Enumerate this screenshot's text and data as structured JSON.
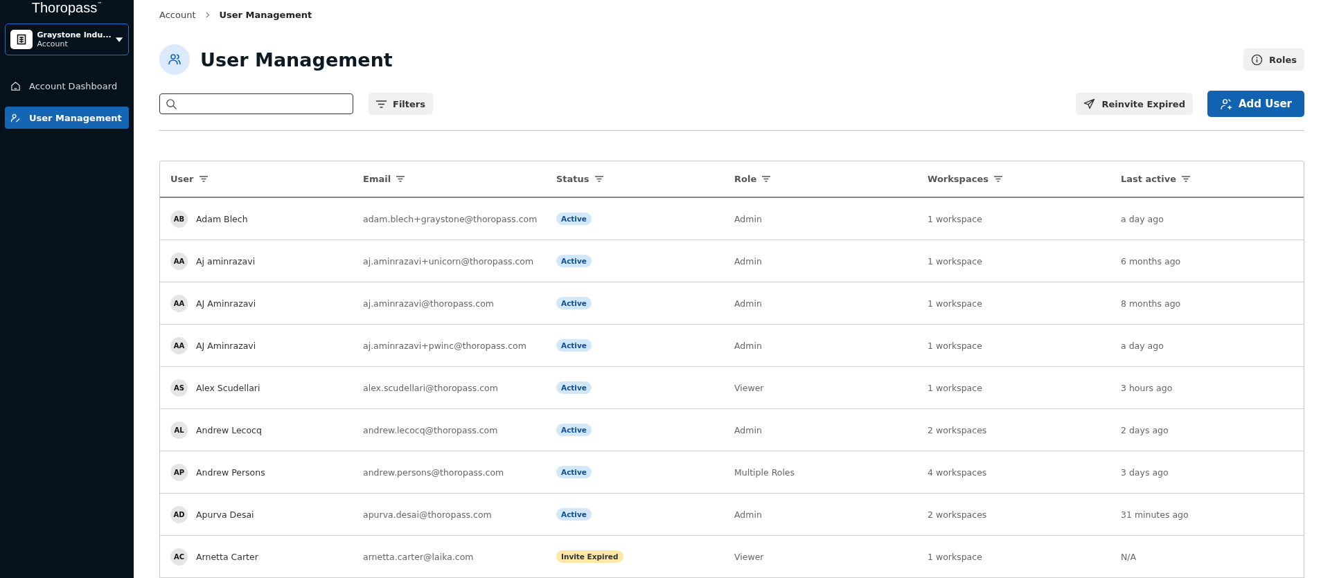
{
  "sidebar": {
    "logo": "Thoropass",
    "logo_mark": "™",
    "account": {
      "name": "Graystone Indu...",
      "subtitle": "Account"
    },
    "items": [
      {
        "label": "Account Dashboard",
        "selected": false
      },
      {
        "label": "User Management",
        "selected": true
      }
    ]
  },
  "breadcrumb": [
    "Account",
    "User Management"
  ],
  "page_title": "User Management",
  "buttons": {
    "roles": "Roles",
    "filters": "Filters",
    "reinvite": "Reinvite Expired",
    "add_user": "Add User"
  },
  "table": {
    "columns": [
      "User",
      "Email",
      "Status",
      "Role",
      "Workspaces",
      "Last active"
    ],
    "rows": [
      {
        "initials": "AB",
        "name": "Adam Blech",
        "email": "adam.blech+graystone@thoropass.com",
        "status": {
          "label": "Active",
          "kind": "active"
        },
        "role": "Admin",
        "workspaces": "1 workspace",
        "last_active": "a day ago"
      },
      {
        "initials": "AA",
        "name": "Aj aminrazavi",
        "email": "aj.aminrazavi+unicorn@thoropass.com",
        "status": {
          "label": "Active",
          "kind": "active"
        },
        "role": "Admin",
        "workspaces": "1 workspace",
        "last_active": "6 months ago"
      },
      {
        "initials": "AA",
        "name": "AJ Aminrazavi",
        "email": "aj.aminrazavi@thoropass.com",
        "status": {
          "label": "Active",
          "kind": "active"
        },
        "role": "Admin",
        "workspaces": "1 workspace",
        "last_active": "8 months ago"
      },
      {
        "initials": "AA",
        "name": "AJ Aminrazavi",
        "email": "aj.aminrazavi+pwinc@thoropass.com",
        "status": {
          "label": "Active",
          "kind": "active"
        },
        "role": "Admin",
        "workspaces": "1 workspace",
        "last_active": "a day ago"
      },
      {
        "initials": "AS",
        "name": "Alex Scudellari",
        "email": "alex.scudellari@thoropass.com",
        "status": {
          "label": "Active",
          "kind": "active"
        },
        "role": "Viewer",
        "workspaces": "1 workspace",
        "last_active": "3 hours ago"
      },
      {
        "initials": "AL",
        "name": "Andrew Lecocq",
        "email": "andrew.lecocq@thoropass.com",
        "status": {
          "label": "Active",
          "kind": "active"
        },
        "role": "Admin",
        "workspaces": "2 workspaces",
        "last_active": "2 days ago"
      },
      {
        "initials": "AP",
        "name": "Andrew Persons",
        "email": "andrew.persons@thoropass.com",
        "status": {
          "label": "Active",
          "kind": "active"
        },
        "role": "Multiple Roles",
        "workspaces": "4 workspaces",
        "last_active": "3 days ago"
      },
      {
        "initials": "AD",
        "name": "Apurva Desai",
        "email": "apurva.desai@thoropass.com",
        "status": {
          "label": "Active",
          "kind": "active"
        },
        "role": "Admin",
        "workspaces": "2 workspaces",
        "last_active": "31 minutes ago"
      },
      {
        "initials": "AC",
        "name": "Arnetta Carter",
        "email": "arnetta.carter@laika.com",
        "status": {
          "label": "Invite Expired",
          "kind": "expired"
        },
        "role": "Viewer",
        "workspaces": "1 workspace",
        "last_active": "N/A"
      }
    ]
  }
}
